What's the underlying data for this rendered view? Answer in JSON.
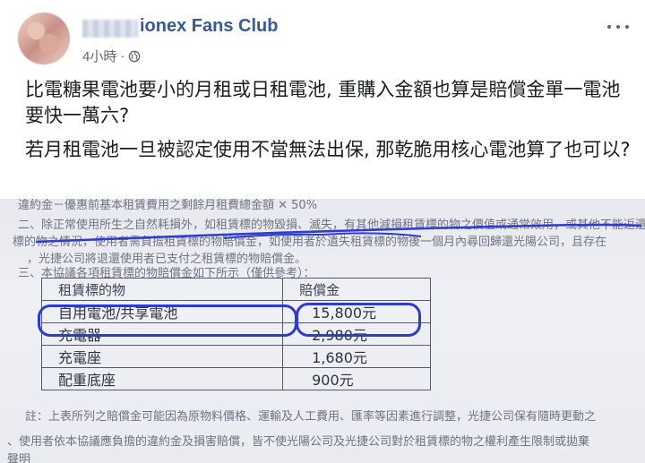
{
  "header": {
    "page_name": "ionex Fans Club",
    "timestamp": "4小時",
    "separator": "·",
    "privacy_icon": "globe-icon",
    "more_icon": "more-options-icon"
  },
  "post": {
    "paragraphs": [
      "比電糖果電池要小的月租或日租電池, 重購入金額也算是賠償金單一電池要快一萬六?",
      "若月租電池一旦被認定使用不當無法出保, 那乾脆用核心電池算了也可以?"
    ]
  },
  "photo": {
    "doc_lines": [
      "違約金－優惠前基本租賃費用之剩餘月租費總金額 ✕ 50%",
      "二、除正常使用所生之自然耗損外，如租賃標的物毀損、滅失，有其他減損租賃標的物之價值或通常效用，或其他不能返還租賃",
      "標的物之情況，使用者需負擔租賃標的物賠償金，如使用者於遺失租賃標的物後一個月內尋回歸還光陽公司，且存在",
      "，光捷公司將退還使用者已支付之租賃標的物賠償金。",
      "三、本協議各項租賃標的物賠償金如下所示（僅供參考）："
    ],
    "table": {
      "headers": [
        "租賃標的物",
        "賠償金"
      ],
      "rows": [
        [
          "自用電池/共享電池",
          "15,800元"
        ],
        [
          "充電器",
          "2,980元"
        ],
        [
          "充電座",
          "1,680元"
        ],
        [
          "配重底座",
          "900元"
        ]
      ]
    },
    "footer_lines": [
      "註：上表所列之賠償金可能因為原物料價格、運輸及人工費用、匯率等因素進行調整，光捷公司保有隨時更動之",
      "、使用者依本協議應負擔的違約金及損害賠償，皆不使光陽公司及光捷公司對於租賃標的物之權利產生限制或拋棄",
      "聲明"
    ],
    "highlight_color": "#2f3ad1"
  }
}
